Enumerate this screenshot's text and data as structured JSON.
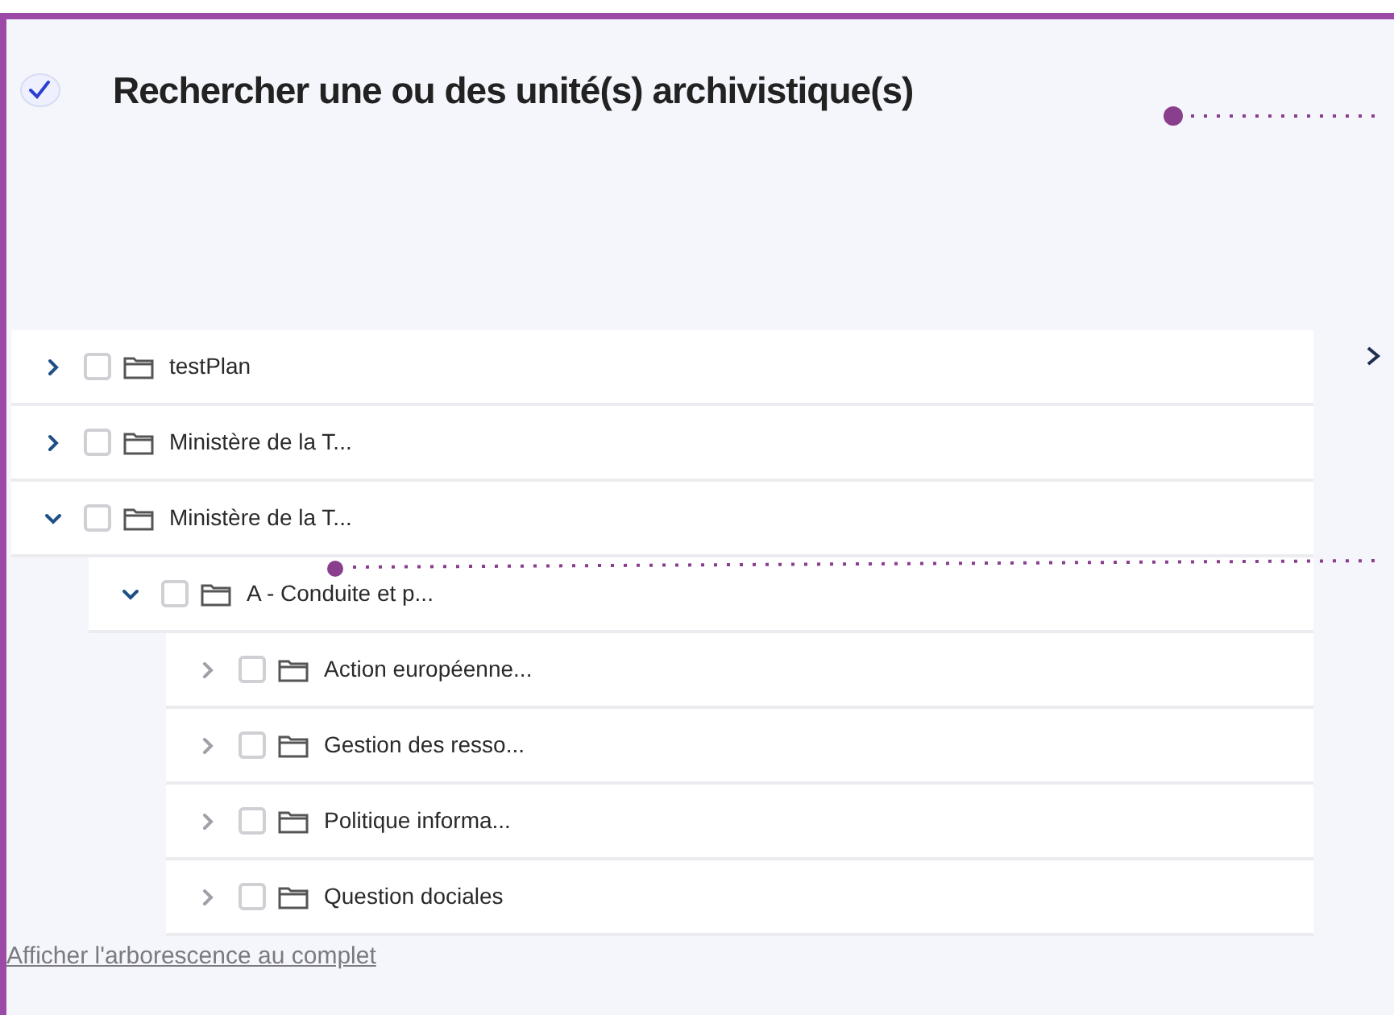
{
  "header": {
    "title": "Rechercher une ou des unité(s) archivistique(s)"
  },
  "tree": [
    {
      "label": "testPlan",
      "expanded": false,
      "checked": false
    },
    {
      "label": "Ministère de la T...",
      "expanded": false,
      "checked": false
    },
    {
      "label": "Ministère de la T...",
      "expanded": true,
      "checked": false,
      "children": [
        {
          "label": "A - Conduite et p...",
          "expanded": true,
          "checked": false,
          "children": [
            {
              "label": "Action européenne...",
              "expanded": false,
              "checked": false
            },
            {
              "label": "Gestion des resso...",
              "expanded": false,
              "checked": false
            },
            {
              "label": "Politique informa...",
              "expanded": false,
              "checked": false
            },
            {
              "label": "Question dociales",
              "expanded": false,
              "checked": false
            }
          ]
        }
      ]
    }
  ],
  "show_full_tree_link": "Afficher l'arborescence au complet"
}
